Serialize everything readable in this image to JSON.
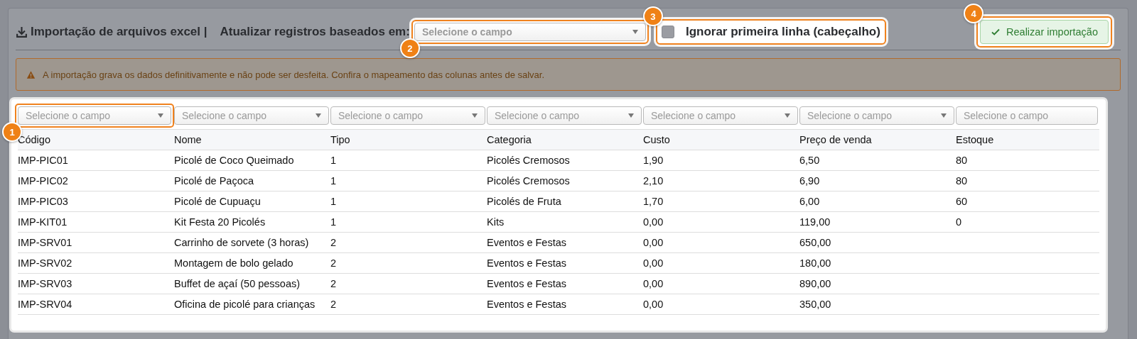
{
  "header": {
    "title": "Importação de arquivos excel |",
    "update_label": "Atualizar registros baseados em:",
    "update_select": {
      "placeholder": "Selecione o campo",
      "badge": "2"
    },
    "ignore_header": {
      "label": "Ignorar primeira linha (cabeçalho)",
      "checked": false,
      "badge": "3"
    },
    "import_button": {
      "label": "Realizar importação",
      "badge": "4"
    }
  },
  "alert": {
    "text": "A importação grava os dados definitivamente e não pode ser desfeita. Confira o mapeamento das colunas antes de salvar."
  },
  "table": {
    "mappings": [
      {
        "placeholder": "Selecione o campo",
        "caret": true,
        "badge": "1"
      },
      {
        "placeholder": "Selecione o campo",
        "caret": true
      },
      {
        "placeholder": "Selecione o campo",
        "caret": true
      },
      {
        "placeholder": "Selecione o campo",
        "caret": true
      },
      {
        "placeholder": "Selecione o campo",
        "caret": true
      },
      {
        "placeholder": "Selecione o campo",
        "caret": true
      },
      {
        "placeholder": "Selecione o campo",
        "caret": false
      }
    ],
    "columns": [
      "Código",
      "Nome",
      "Tipo",
      "Categoria",
      "Custo",
      "Preço de venda",
      "Estoque"
    ],
    "rows": [
      [
        "IMP-PIC01",
        "Picolé de Coco Queimado",
        "1",
        "Picolés Cremosos",
        "1,90",
        "6,50",
        "80"
      ],
      [
        "IMP-PIC02",
        "Picolé de Paçoca",
        "1",
        "Picolés Cremosos",
        "2,10",
        "6,90",
        "80"
      ],
      [
        "IMP-PIC03",
        "Picolé de Cupuaçu",
        "1",
        "Picolés de Fruta",
        "1,70",
        "6,00",
        "60"
      ],
      [
        "IMP-KIT01",
        "Kit Festa 20 Picolés",
        "1",
        "Kits",
        "0,00",
        "119,00",
        "0"
      ],
      [
        "IMP-SRV01",
        "Carrinho de sorvete (3 horas)",
        "2",
        "Eventos e Festas",
        "0,00",
        "650,00"
      ],
      [
        "IMP-SRV02",
        "Montagem de bolo gelado",
        "2",
        "Eventos e Festas",
        "0,00",
        "180,00"
      ],
      [
        "IMP-SRV03",
        "Buffet de açaí (50 pessoas)",
        "2",
        "Eventos e Festas",
        "0,00",
        "890,00"
      ],
      [
        "IMP-SRV04",
        "Oficina de picolé para crianças",
        "2",
        "Eventos e Festas",
        "0,00",
        "350,00"
      ]
    ]
  }
}
